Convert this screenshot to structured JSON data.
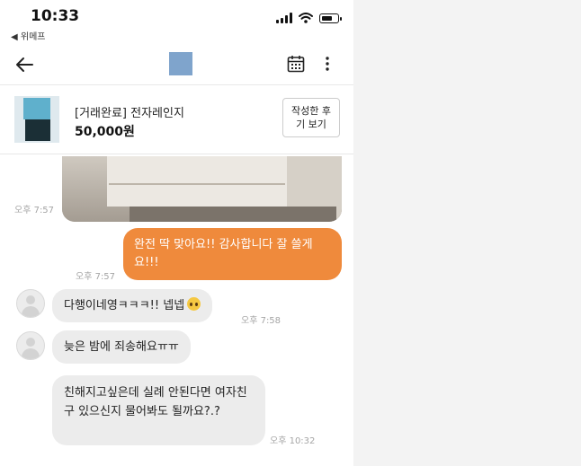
{
  "status_bar": {
    "time": "10:33",
    "back_app": "◀ 위메프"
  },
  "product": {
    "title": "[거래완료] 전자레인지",
    "price": "50,000원",
    "review_button": "작성한 후기 보기"
  },
  "messages": {
    "photo_time": "오후 7:57",
    "sent_text": "완전 딱 맞아요!! 감사합니다 잘 쓸게요!!!",
    "sent_time": "오후 7:57",
    "recv1_text": "다행이네영ㅋㅋㅋ!! 넵넵",
    "recv1_time": "오후 7:58",
    "recv2_text": "늦은 밤에 죄송해요ㅠㅠ",
    "recv3_text": "친해지고싶은데 실례 안된다면 여자친구 있으신지 물어봐도 될까요?.?",
    "recv3_time": "오후 10:32"
  },
  "icons": {
    "back": "back-arrow-icon",
    "calendar": "calendar-icon",
    "more": "more-vertical-icon",
    "emoji": "pleading-face-emoji"
  },
  "colors": {
    "sent_bubble": "#ef8a3c",
    "received_bubble": "#ececec",
    "avatar_square": "#7fa4cc"
  }
}
